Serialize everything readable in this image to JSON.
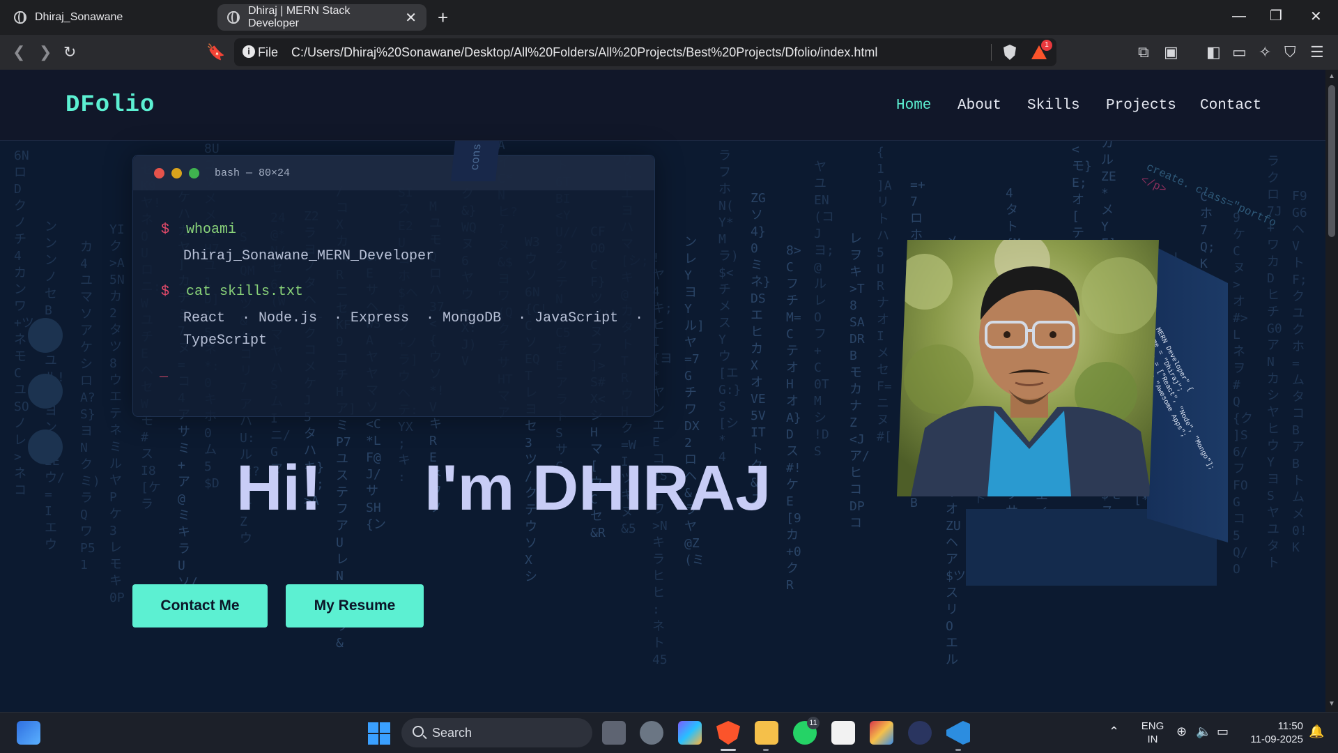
{
  "browser": {
    "tabs": [
      {
        "title": "Dhiraj_Sonawane",
        "active": false
      },
      {
        "title": "Dhiraj | MERN Stack Developer",
        "active": true
      }
    ],
    "url_scheme_label": "File",
    "url": "C:/Users/Dhiraj%20Sonawane/Desktop/All%20Folders/All%20Projects/Best%20Projects/Dfolio/index.html",
    "rewards_badge": "1"
  },
  "site": {
    "logo": "DFolio",
    "nav": [
      {
        "label": "Home",
        "active": true
      },
      {
        "label": "About",
        "active": false
      },
      {
        "label": "Skills",
        "active": false
      },
      {
        "label": "Projects",
        "active": false
      },
      {
        "label": "Contact",
        "active": false
      }
    ],
    "accent_color": "#5cf0d2"
  },
  "terminal": {
    "title": "bash — 80×24",
    "prompt": "$",
    "commands": [
      {
        "cmd": "whoami",
        "output": "Dhiraj_Sonawane_MERN_Developer"
      },
      {
        "cmd": "cat skills.txt",
        "output_line1": "React  · Node.js  · Express  · MongoDB  · JavaScript  ·",
        "output_line2": "TypeScript"
      }
    ],
    "cursor": "_"
  },
  "hero": {
    "greeting": "Hi!",
    "name_line": "I'm DHIRAJ",
    "buttons": {
      "contact": "Contact Me",
      "resume": "My Resume"
    }
  },
  "decor": {
    "cons_tag": "cons",
    "diag_code_1": "create. class=\"portfo",
    "diag_code_2": "</p>",
    "photo_side_code": "MERN Developer\" {\nname = \"Dhiraj\";\nskills = [\"React\", \"Node\", \"Mongo\"];\nbuild() => \"Awesome Apps\";"
  },
  "taskbar": {
    "search_placeholder": "Search",
    "whatsapp_badge": "11",
    "lang_line1": "ENG",
    "lang_line2": "IN",
    "time": "11:50",
    "date": "11-09-2025"
  }
}
